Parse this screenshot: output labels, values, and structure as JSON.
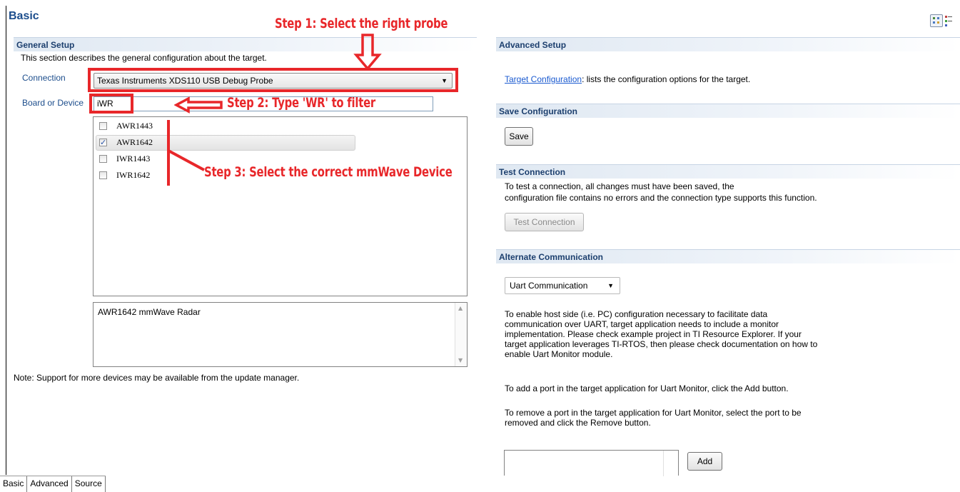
{
  "page": {
    "title": "Basic"
  },
  "general_setup": {
    "header": "General Setup",
    "description": "This section describes the general configuration about the target.",
    "connection_label": "Connection",
    "connection_value": "Texas Instruments XDS110 USB Debug Probe",
    "board_label": "Board or Device",
    "filter_value": "iWR",
    "devices": [
      {
        "label": "AWR1443",
        "checked": false
      },
      {
        "label": "AWR1642",
        "checked": true
      },
      {
        "label": "IWR1443",
        "checked": false
      },
      {
        "label": "IWR1642",
        "checked": false
      }
    ],
    "description_box": "AWR1642 mmWave Radar",
    "note": "Note: Support for more devices may be available from the update manager."
  },
  "annotations": {
    "step1": "Step 1: Select the right probe",
    "step2": "Step 2: Type 'WR' to filter",
    "step3": "Step 3: Select the correct mmWave Device",
    "color": "#e8272a"
  },
  "advanced_setup": {
    "header": "Advanced Setup",
    "link_text": "Target Configuration",
    "link_suffix": ": lists the configuration options for the target."
  },
  "save_configuration": {
    "header": "Save Configuration",
    "save_button": "Save"
  },
  "test_connection": {
    "header": "Test Connection",
    "line1": "To test a connection, all changes must have been saved, the",
    "line2": "configuration file contains no errors and the connection type supports this function.",
    "button": "Test Connection"
  },
  "alternate_communication": {
    "header": "Alternate Communication",
    "dropdown_value": "Uart Communication",
    "para1": [
      "To enable host side (i.e. PC) configuration necessary to facilitate data",
      "communication over UART, target application needs to include a monitor",
      "implementation. Please check example project in TI Resource Explorer. If your",
      "target application leverages TI-RTOS, then please check documentation on how to",
      "enable Uart Monitor module."
    ],
    "para2": "To add a port in the target application for Uart Monitor, click the Add button.",
    "para3": [
      "To remove a port in the target application for Uart Monitor, select the port to be",
      "removed and click the Remove button."
    ],
    "add_button": "Add"
  },
  "bottom_tabs": [
    "Basic",
    "Advanced",
    "Source"
  ]
}
